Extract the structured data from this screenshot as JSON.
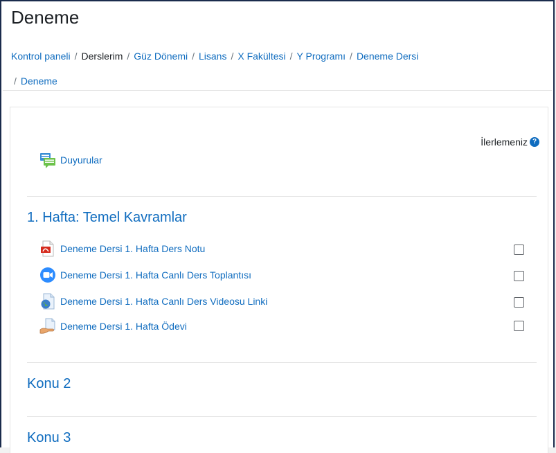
{
  "page": {
    "title": "Deneme"
  },
  "breadcrumb": [
    {
      "label": "Kontrol paneli",
      "link": true
    },
    {
      "label": "Derslerim",
      "link": false
    },
    {
      "label": "Güz Dönemi",
      "link": true
    },
    {
      "label": "Lisans",
      "link": true
    },
    {
      "label": "X Fakültesi",
      "link": true
    },
    {
      "label": "Y Programı",
      "link": true
    },
    {
      "label": "Deneme Dersi",
      "link": true
    },
    {
      "label": "Deneme",
      "link": true
    }
  ],
  "course": {
    "progress_label": "İlerlemeniz",
    "help_symbol": "?",
    "announcements": {
      "label": "Duyurular",
      "icon": "forum-icon"
    },
    "sections": [
      {
        "title": "1. Hafta: Temel Kavramlar",
        "activities": [
          {
            "label": "Deneme Dersi 1. Hafta Ders Notu",
            "icon": "pdf-icon",
            "completed": false
          },
          {
            "label": "Deneme Dersi 1. Hafta Canlı Ders Toplantısı",
            "icon": "zoom-icon",
            "completed": false
          },
          {
            "label": "Deneme Dersi 1. Hafta Canlı Ders Videosu Linki",
            "icon": "url-icon",
            "completed": false
          },
          {
            "label": "Deneme Dersi 1. Hafta Ödevi",
            "icon": "assignment-icon",
            "completed": false
          }
        ]
      },
      {
        "title": "Konu 2",
        "activities": []
      },
      {
        "title": "Konu 3",
        "activities": []
      }
    ]
  },
  "colors": {
    "link": "#0f6cbf",
    "frame_border": "#1a2b4c"
  }
}
